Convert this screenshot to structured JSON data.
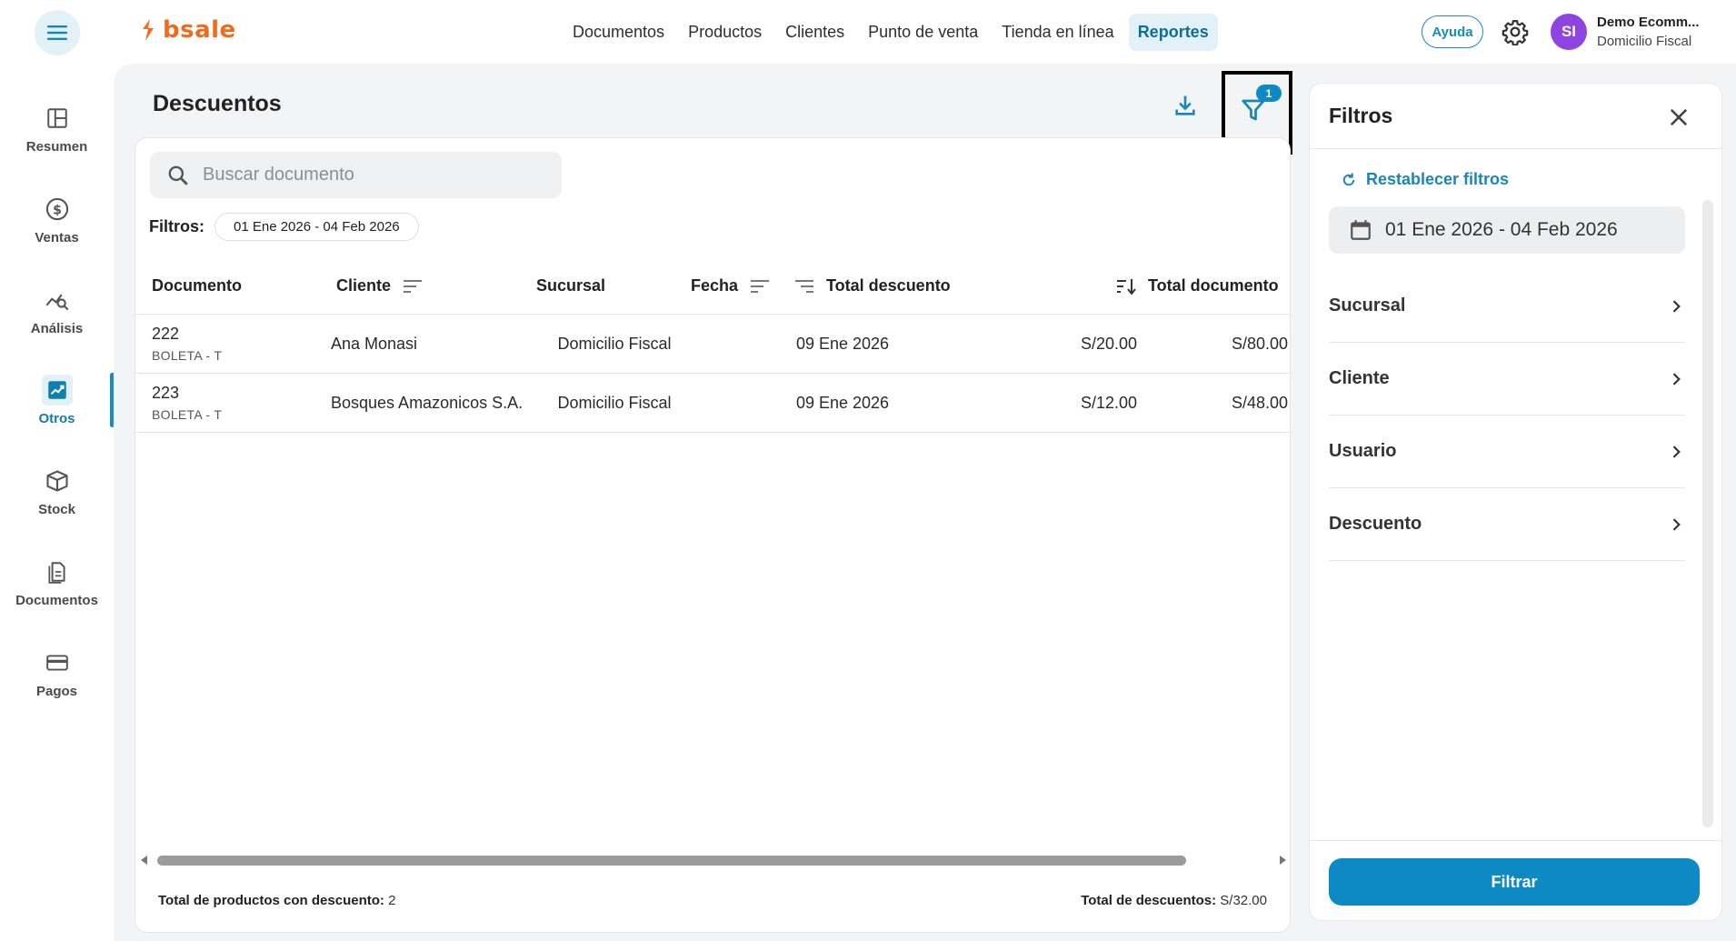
{
  "brand": {
    "name": "bsale",
    "color": "#f26a1b"
  },
  "accent_color": "#0d8ac4",
  "nav": {
    "items": [
      {
        "label": "Documentos"
      },
      {
        "label": "Productos"
      },
      {
        "label": "Clientes"
      },
      {
        "label": "Punto de venta"
      },
      {
        "label": "Tienda en línea"
      },
      {
        "label": "Reportes",
        "active": true
      }
    ]
  },
  "header": {
    "help_label": "Ayuda",
    "user_initials": "SI",
    "user_name": "Demo Ecomm...",
    "user_branch": "Domicilio Fiscal"
  },
  "sidebar": {
    "items": [
      {
        "label": "Resumen",
        "icon": "dashboard-icon"
      },
      {
        "label": "Ventas",
        "icon": "dollar-icon"
      },
      {
        "label": "Análisis",
        "icon": "analytics-icon"
      },
      {
        "label": "Otros",
        "icon": "trend-icon",
        "active": true
      },
      {
        "label": "Stock",
        "icon": "box-icon"
      },
      {
        "label": "Documentos",
        "icon": "documents-icon"
      },
      {
        "label": "Pagos",
        "icon": "card-icon"
      }
    ]
  },
  "main": {
    "title": "Descuentos",
    "filter_badge": "1",
    "search_placeholder": "Buscar documento",
    "filters_label": "Filtros:",
    "filters_chip": "01 Ene 2026 - 04 Feb 2026",
    "columns": [
      "Documento",
      "Cliente",
      "Sucursal",
      "Fecha",
      "Total descuento",
      "Total documento"
    ],
    "rows": [
      {
        "number": "222",
        "type": "BOLETA - T",
        "cliente": "Ana Monasi",
        "sucursal": "Domicilio Fiscal",
        "fecha": "09 Ene 2026",
        "total_descuento": "S/20.00",
        "total_documento": "S/80.00"
      },
      {
        "number": "223",
        "type": "BOLETA - T",
        "cliente": "Bosques Amazonicos S.A.",
        "sucursal": "Domicilio Fiscal",
        "fecha": "09 Ene 2026",
        "total_descuento": "S/12.00",
        "total_documento": "S/48.00"
      }
    ],
    "footer_left_label": "Total de productos con descuento:",
    "footer_left_value": "2",
    "footer_right_label": "Total de descuentos:",
    "footer_right_value": "S/32.00"
  },
  "panel": {
    "title": "Filtros",
    "reset_label": "Restablecer filtros",
    "date_range": "01 Ene 2026 - 04 Feb 2026",
    "sections": [
      "Sucursal",
      "Cliente",
      "Usuario",
      "Descuento"
    ],
    "apply_label": "Filtrar"
  }
}
